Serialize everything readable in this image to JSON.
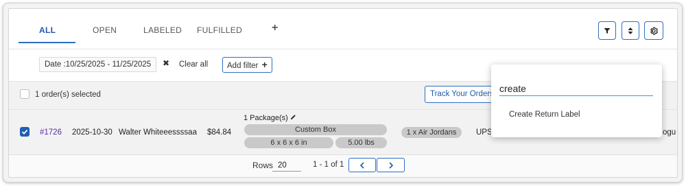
{
  "tabs": [
    {
      "label": "ALL",
      "active": true
    },
    {
      "label": "OPEN",
      "active": false
    },
    {
      "label": "LABELED",
      "active": false
    },
    {
      "label": "FULFILLED",
      "active": false
    }
  ],
  "tab_add_glyph": "+",
  "toolbar": {
    "icons": [
      "filter-icon",
      "sort-icon",
      "gear-icon"
    ]
  },
  "filters": {
    "chip_label": "Date :10/25/2025 - 11/25/2025",
    "chip_remove_glyph": "✖",
    "clear_all": "Clear all",
    "add_filter_label": "Add filter",
    "add_filter_glyph": "+"
  },
  "selection": {
    "text": "1 order(s) selected",
    "track_button": "Track Your Orders"
  },
  "order": {
    "id": "#1726",
    "date": "2025-10-30",
    "customer": "Walter Whiteeessssaa",
    "total": "$84.84",
    "packages_label": "1 Package(s)",
    "box_name": "Custom Box",
    "dimensions": "6 x 6 x 6 in",
    "weight": "5.00 lbs",
    "items": "1 x Air Jordans",
    "carrier": "UPS",
    "trailing_text": "ogu",
    "checked": true
  },
  "pagination": {
    "rows_label": "Rows",
    "rows_value": "20",
    "range": "1 - 1 of 1"
  },
  "dropdown": {
    "search_value": "create",
    "options": [
      "Create Return Label"
    ]
  },
  "colors": {
    "accent": "#2c6dc0",
    "link_purple": "#5a2ea6",
    "row_gray": "#f2f2f2",
    "pill_gray": "#c9c9c9",
    "input_underline": "#2aa3b8"
  }
}
